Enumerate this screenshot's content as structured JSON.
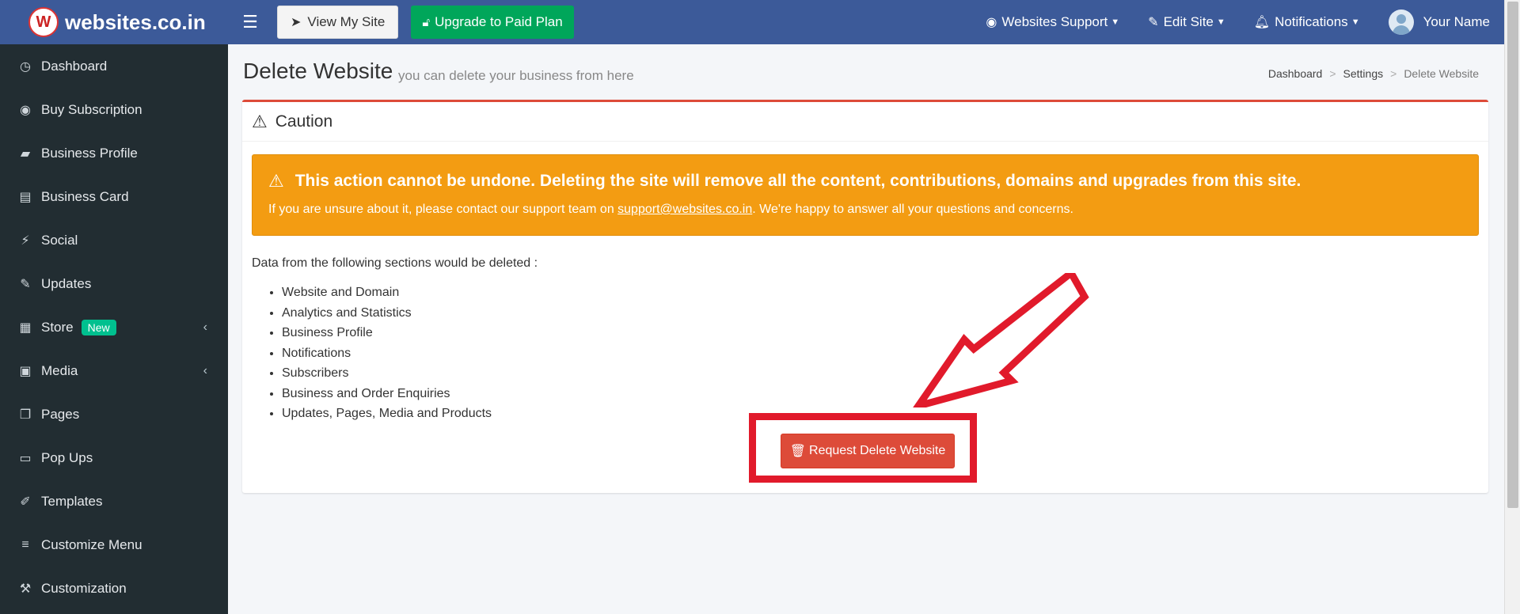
{
  "brand": {
    "logo_letter": "W",
    "name": "websites.co.in"
  },
  "topbar": {
    "menu_icon": "☰",
    "view_site": "View My Site",
    "upgrade": "Upgrade to Paid Plan",
    "support": "Websites Support",
    "edit_site": "Edit Site",
    "notifications": "Notifications",
    "user_name": "Your Name"
  },
  "sidebar": {
    "items": [
      {
        "label": "Dashboard",
        "icon": "dashboard-icon"
      },
      {
        "label": "Buy Subscription",
        "icon": "circle-dot-icon"
      },
      {
        "label": "Business Profile",
        "icon": "briefcase-icon"
      },
      {
        "label": "Business Card",
        "icon": "id-card-icon"
      },
      {
        "label": "Social",
        "icon": "plug-icon"
      },
      {
        "label": "Updates",
        "icon": "pencil-icon"
      },
      {
        "label": "Store",
        "icon": "building-icon",
        "badge": "New"
      },
      {
        "label": "Media",
        "icon": "image-icon"
      },
      {
        "label": "Pages",
        "icon": "copy-icon"
      },
      {
        "label": "Pop Ups",
        "icon": "window-icon"
      },
      {
        "label": "Templates",
        "icon": "brush-icon"
      },
      {
        "label": "Customize Menu",
        "icon": "bars-icon"
      },
      {
        "label": "Customization",
        "icon": "wrench-icon"
      }
    ]
  },
  "page": {
    "title": "Delete Website",
    "subtitle": "you can delete your business from here"
  },
  "breadcrumb": {
    "items": [
      "Dashboard",
      "Settings",
      "Delete Website"
    ]
  },
  "card": {
    "header": "Caution"
  },
  "alert": {
    "title": "This action cannot be undone. Deleting the site will remove all the content, contributions, domains and upgrades from this site.",
    "text_before": "If you are unsure about it, please contact our support team on ",
    "email": "support@websites.co.in",
    "text_after": ". We're happy to answer all your questions and concerns."
  },
  "intro": "Data from the following sections would be deleted :",
  "sections": [
    "Website and Domain",
    "Analytics and Statistics",
    "Business Profile",
    "Notifications",
    "Subscribers",
    "Business and Order Enquiries",
    "Updates, Pages, Media and Products"
  ],
  "delete_button": "Request Delete Website",
  "colors": {
    "topbar": "#3c5a99",
    "sidebar": "#222d32",
    "upgrade_green": "#00a65a",
    "alert_orange": "#f39c12",
    "danger_red": "#dd4b39",
    "annotation_red": "#e11a2b"
  }
}
